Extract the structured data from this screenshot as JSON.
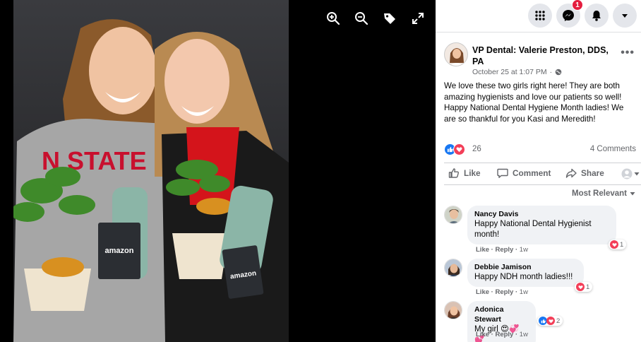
{
  "viewer": {
    "tools": [
      "zoom-in",
      "zoom-out",
      "tag",
      "fullscreen"
    ],
    "gift_card_text": "amazon"
  },
  "topbar": {
    "messenger_badge": "1"
  },
  "post": {
    "author": "VP Dental: Valerie Preston, DDS, PA",
    "timestamp": "October 25 at 1:07 PM",
    "privacy_separator": "·",
    "text": "We love these two girls right here! They are both amazing hygienists and love our patients so well! Happy National Dental Hygiene Month ladies! We are so thankful for you Kasi and Meredith!",
    "reaction_count": "26",
    "comment_count": "4 Comments",
    "actions": {
      "like": "Like",
      "comment": "Comment",
      "share": "Share"
    },
    "sort_label": "Most Relevant"
  },
  "comments": [
    {
      "name": "Nancy Davis",
      "text": "Happy National Dental Hygienist month!",
      "like": "Like",
      "reply": "Reply",
      "time": "1w",
      "reactions": "1"
    },
    {
      "name": "Debbie Jamison",
      "text": "Happy NDH month ladies!!!",
      "like": "Like",
      "reply": "Reply",
      "time": "1w",
      "reactions": "1"
    },
    {
      "name": "Adonica Stewart",
      "text": "My girl 😍💞💕",
      "like": "Like",
      "reply": "Reply",
      "time": "1w",
      "reactions": "2"
    }
  ],
  "colors": {
    "facebook_blue": "#1877f2",
    "love_red": "#f33e58",
    "badge_red": "#e41e3f"
  }
}
